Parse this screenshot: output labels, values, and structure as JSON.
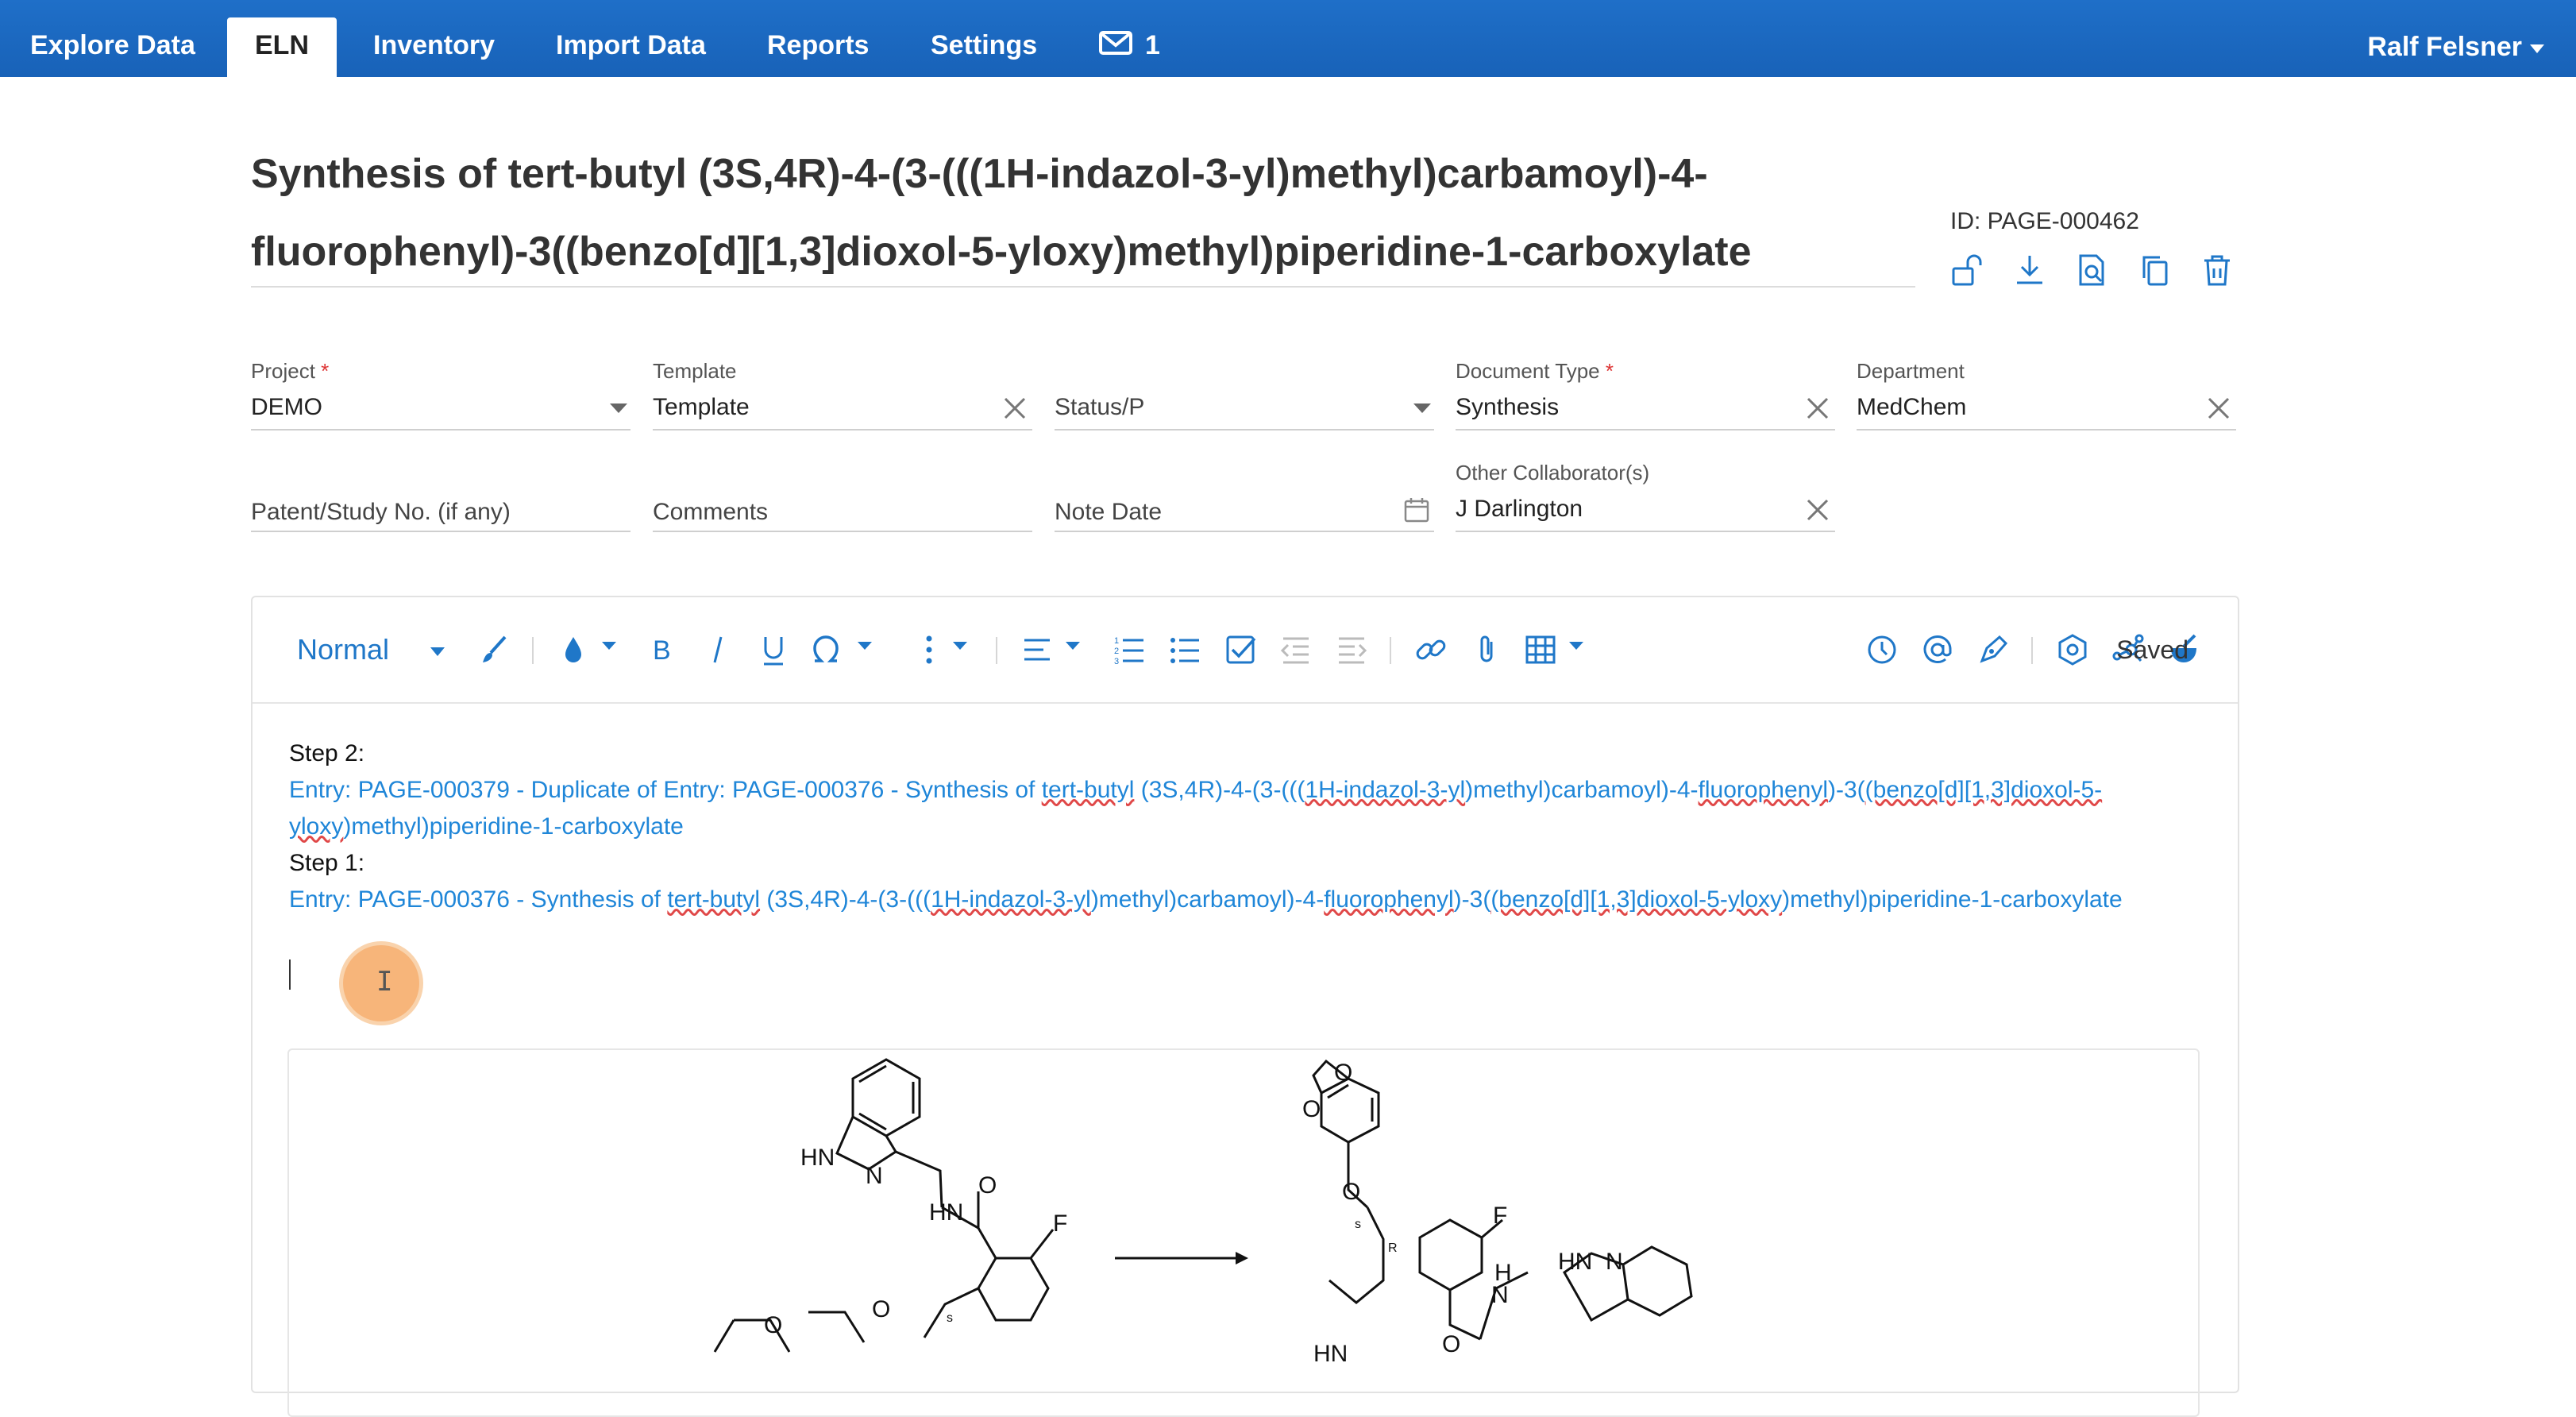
{
  "nav": {
    "tabs": [
      {
        "label": "Explore Data"
      },
      {
        "label": "ELN"
      },
      {
        "label": "Inventory"
      },
      {
        "label": "Import Data"
      },
      {
        "label": "Reports"
      },
      {
        "label": "Settings"
      }
    ],
    "messages_count": "1",
    "user_name": "Ralf Felsner"
  },
  "document": {
    "title": "Synthesis of tert-butyl (3S,4R)-4-(3-(((1H-indazol-3-yl)methyl)carbamoyl)-4-fluorophenyl)-3((benzo[d][1,3]dioxol-5-yloxy)methyl)piperidine-1-carboxylate",
    "id_label": "ID: PAGE-000462"
  },
  "fields": {
    "project": {
      "label": "Project",
      "value": "DEMO"
    },
    "template": {
      "label": "Template",
      "value": "Template"
    },
    "status": {
      "placeholder": "Status/P"
    },
    "document_type": {
      "label": "Document Type",
      "value": "Synthesis"
    },
    "department": {
      "label": "Department",
      "value": "MedChem"
    },
    "patent": {
      "placeholder": "Patent/Study No. (if any)"
    },
    "comments": {
      "placeholder": "Comments"
    },
    "note_date": {
      "placeholder": "Note Date"
    },
    "collaborators": {
      "label": "Other Collaborator(s)",
      "value": "J Darlington"
    }
  },
  "editor": {
    "style_select": "Normal",
    "status": "Saved",
    "step2_label": "Step 2:",
    "step2_link_a": "Entry: PAGE-000379 - Duplicate of Entry: PAGE-000376 - Synthesis of ",
    "step2_link_b": "tert-butyl",
    "step2_link_c": " (3S,4R)-4-(3-(((",
    "step2_link_d": "1H-indazol-3-yl",
    "step2_link_e": ")methyl)carbamoyl)-4-",
    "step2_link_f": "fluorophenyl",
    "step2_link_g": ")-3(",
    "step2_link_h": "(benzo[d][1,3]dioxol-5-",
    "step2_link_i": "yloxy",
    "step2_link_j": ")methyl)piperidine-1-carboxylate",
    "step1_label": "Step 1:",
    "step1_link_a": "Entry: PAGE-000376 - Synthesis of ",
    "step1_link_b": "tert-butyl",
    "step1_link_c": " (3S,4R)-4-(3-(((",
    "step1_link_d": "1H-indazol-3-yl",
    "step1_link_e": ")methyl)carbamoyl)-4-",
    "step1_link_f": "fluorophenyl",
    "step1_link_g": ")-3(",
    "step1_link_h": "(benzo[d][1,3]dioxol-5-yloxy",
    "step1_link_i": ")methyl)piperidine-1-carboxylate"
  },
  "scheme_labels": {
    "hn": "HN",
    "n": "N",
    "o": "O",
    "f": "F",
    "s": "s",
    "r": "R",
    "h": "H",
    "nh": "HN"
  },
  "colors": {
    "nav": "#1f6fc8",
    "accent": "#1f77c8",
    "link": "#1f86d8"
  }
}
